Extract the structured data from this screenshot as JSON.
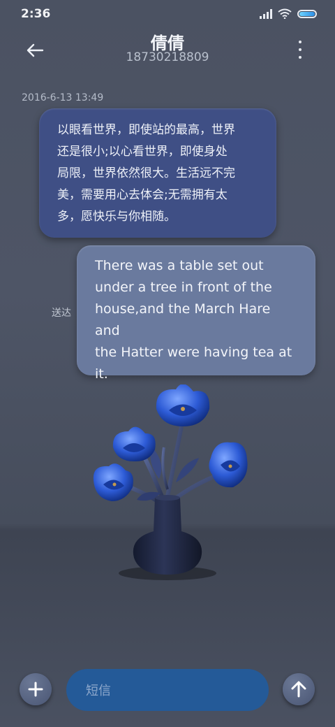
{
  "status_bar": {
    "time": "2:36",
    "icons": [
      "signal-icon",
      "wifi-icon",
      "battery-icon"
    ]
  },
  "header": {
    "contact_name": "倩倩",
    "contact_phone": "18730218809",
    "back_icon": "arrow-left-icon",
    "more_icon": "more-vertical-icon"
  },
  "conversation": {
    "timestamp": "2016-6-13 13:49",
    "messages": [
      {
        "direction": "incoming",
        "lines": [
          "以眼看世界，即使站的最高，世界",
          "还是很小;以心看世界，即使身处",
          "局限，世界依然很大。生活远不完",
          "美，需要用心去体会;无需拥有太",
          "多，愿快乐与你相随。"
        ]
      },
      {
        "direction": "outgoing",
        "lines": [
          "There was a table set out",
          "under a tree in front of the",
          "house,and the March Hare and",
          "the Hatter were having tea at",
          "it."
        ],
        "status": "送达"
      }
    ]
  },
  "composer": {
    "placeholder": "短信",
    "attach_icon": "plus-icon",
    "send_icon": "arrow-up-icon"
  },
  "colors": {
    "background": "#4b5262",
    "incoming_bubble": "#3f4f85",
    "outgoing_bubble": "#6a7a9e",
    "input": "#245a98"
  }
}
